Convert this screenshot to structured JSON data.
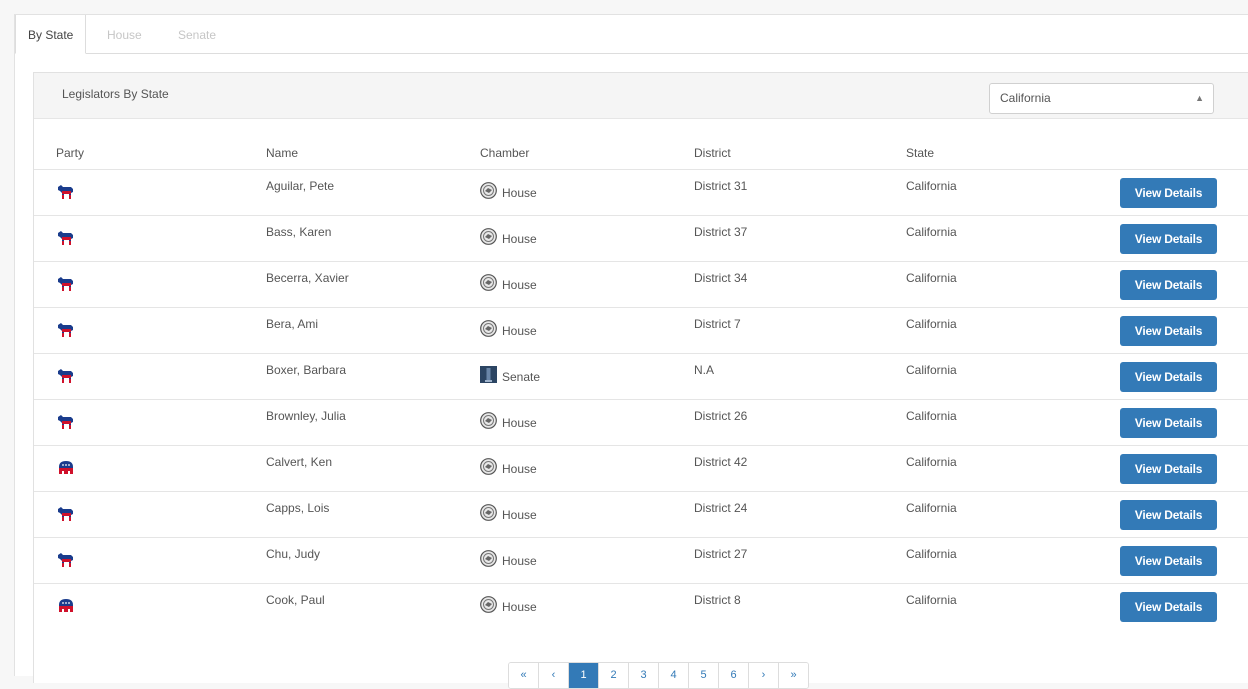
{
  "tabs": [
    {
      "label": "By State",
      "active": true
    },
    {
      "label": "House",
      "active": false
    },
    {
      "label": "Senate",
      "active": false
    }
  ],
  "panel": {
    "title": "Legislators By State",
    "state_select": {
      "value": "California"
    }
  },
  "table": {
    "headers": [
      "Party",
      "Name",
      "Chamber",
      "District",
      "State"
    ],
    "button_label": "View Details",
    "rows": [
      {
        "party": "democrat",
        "name": "Aguilar, Pete",
        "chamber": "House",
        "district": "District 31",
        "state": "California"
      },
      {
        "party": "democrat",
        "name": "Bass, Karen",
        "chamber": "House",
        "district": "District 37",
        "state": "California"
      },
      {
        "party": "democrat",
        "name": "Becerra, Xavier",
        "chamber": "House",
        "district": "District 34",
        "state": "California"
      },
      {
        "party": "democrat",
        "name": "Bera, Ami",
        "chamber": "House",
        "district": "District 7",
        "state": "California"
      },
      {
        "party": "democrat",
        "name": "Boxer, Barbara",
        "chamber": "Senate",
        "district": "N.A",
        "state": "California"
      },
      {
        "party": "democrat",
        "name": "Brownley, Julia",
        "chamber": "House",
        "district": "District 26",
        "state": "California"
      },
      {
        "party": "republican",
        "name": "Calvert, Ken",
        "chamber": "House",
        "district": "District 42",
        "state": "California"
      },
      {
        "party": "democrat",
        "name": "Capps, Lois",
        "chamber": "House",
        "district": "District 24",
        "state": "California"
      },
      {
        "party": "democrat",
        "name": "Chu, Judy",
        "chamber": "House",
        "district": "District 27",
        "state": "California"
      },
      {
        "party": "republican",
        "name": "Cook, Paul",
        "chamber": "House",
        "district": "District 8",
        "state": "California"
      }
    ]
  },
  "pagination": {
    "items": [
      "«",
      "‹",
      "1",
      "2",
      "3",
      "4",
      "5",
      "6",
      "›",
      "»"
    ],
    "active": "1"
  },
  "colors": {
    "accent": "#337ab7",
    "democrat_blue": "#1a3c8c",
    "party_red": "#d0112b"
  }
}
